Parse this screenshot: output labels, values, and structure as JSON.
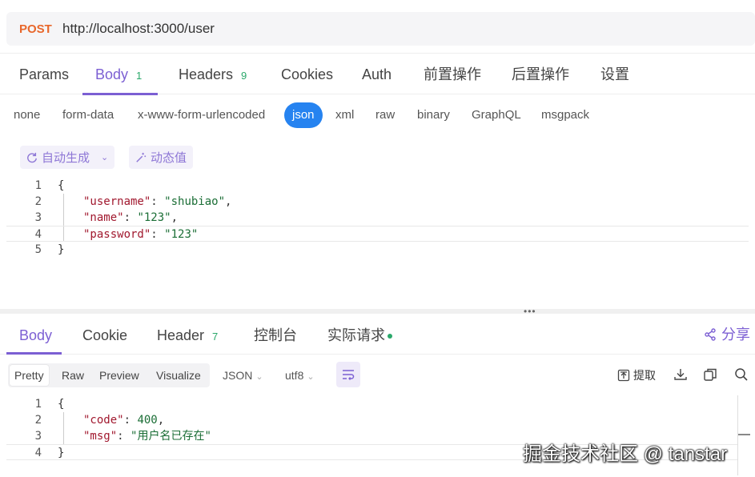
{
  "request": {
    "method": "POST",
    "url": "http://localhost:3000/user"
  },
  "request_tabs": [
    {
      "label": "Params"
    },
    {
      "label": "Body",
      "count": "1"
    },
    {
      "label": "Headers",
      "count": "9"
    },
    {
      "label": "Cookies"
    },
    {
      "label": "Auth"
    },
    {
      "label": "前置操作"
    },
    {
      "label": "后置操作"
    },
    {
      "label": "设置"
    }
  ],
  "active_request_tab": "Body",
  "body_types": [
    "none",
    "form-data",
    "x-www-form-urlencoded",
    "json",
    "xml",
    "raw",
    "binary",
    "GraphQL",
    "msgpack"
  ],
  "active_body_type": "json",
  "tools": {
    "auto_generate": "自动生成",
    "dynamic_value": "动态值"
  },
  "request_body": {
    "line_numbers": [
      "1",
      "2",
      "3",
      "4",
      "5"
    ],
    "open_brace": "{",
    "close_brace": "}",
    "fields": [
      {
        "key": "\"username\"",
        "value": "\"shubiao\"",
        "trail": ","
      },
      {
        "key": "\"name\"",
        "value": "\"123\"",
        "trail": ","
      },
      {
        "key": "\"password\"",
        "value": "\"123\"",
        "trail": ""
      }
    ]
  },
  "response_tabs": [
    {
      "label": "Body"
    },
    {
      "label": "Cookie"
    },
    {
      "label": "Header",
      "count": "7"
    },
    {
      "label": "控制台"
    },
    {
      "label": "实际请求"
    }
  ],
  "active_response_tab": "Body",
  "share_label": "分享",
  "response_toolbar": {
    "views": [
      "Pretty",
      "Raw",
      "Preview",
      "Visualize"
    ],
    "active_view": "Pretty",
    "format": "JSON",
    "encoding": "utf8",
    "extract_label": "提取"
  },
  "response_body": {
    "line_numbers": [
      "1",
      "2",
      "3",
      "4"
    ],
    "open_brace": "{",
    "close_brace": "}",
    "fields": [
      {
        "key": "\"code\"",
        "value": "400",
        "trail": ","
      },
      {
        "key": "\"msg\"",
        "value": "\"用户名已存在\"",
        "trail": ""
      }
    ]
  },
  "watermark": "掘金技术社区 @ tanstar",
  "colors": {
    "accent": "#7c5fd3",
    "method_post": "#e8672b",
    "json_active": "#2683f0",
    "count_green": "#2aa86a"
  }
}
